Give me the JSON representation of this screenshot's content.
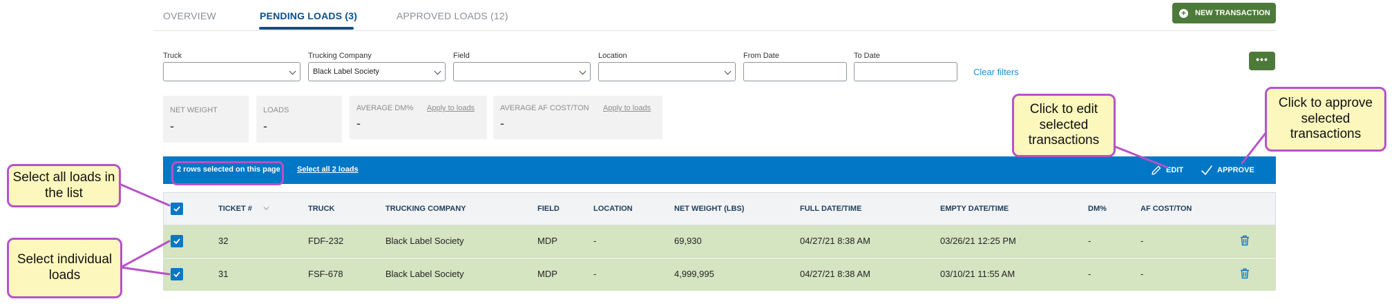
{
  "tabs": [
    {
      "label": "OVERVIEW"
    },
    {
      "label": "PENDING LOADS (3)"
    },
    {
      "label": "APPROVED LOADS (12)"
    }
  ],
  "new_transaction_label": "NEW TRANSACTION",
  "filters": {
    "truck": {
      "label": "Truck",
      "value": ""
    },
    "trucking_company": {
      "label": "Trucking Company",
      "value": "Black Label Society"
    },
    "field": {
      "label": "Field",
      "value": ""
    },
    "location": {
      "label": "Location",
      "value": ""
    },
    "from_date": {
      "label": "From Date",
      "value": ""
    },
    "to_date": {
      "label": "To Date",
      "value": ""
    },
    "clear_label": "Clear filters",
    "more_label": "•••"
  },
  "stats": [
    {
      "label": "NET WEIGHT",
      "value": "-"
    },
    {
      "label": "LOADS",
      "value": "-"
    },
    {
      "label": "AVERAGE DM%",
      "value": "-",
      "link": "Apply to loads"
    },
    {
      "label": "AVERAGE AF COST/TON",
      "value": "-",
      "link": "Apply to loads"
    }
  ],
  "selection": {
    "text": "2 rows selected on this page",
    "select_all": "Select all 2 loads",
    "edit": "EDIT",
    "approve": "APPROVE"
  },
  "table": {
    "columns": [
      "TICKET #",
      "TRUCK",
      "TRUCKING COMPANY",
      "FIELD",
      "LOCATION",
      "NET WEIGHT (LBS)",
      "FULL DATE/TIME",
      "EMPTY DATE/TIME",
      "DM%",
      "AF COST/TON"
    ],
    "rows": [
      {
        "ticket": "32",
        "truck": "FDF-232",
        "company": "Black Label Society",
        "field": "MDP",
        "location": "-",
        "net_weight": "69,930",
        "full_date": "04/27/21 8:38 AM",
        "empty_date": "03/26/21 12:25 PM",
        "dm": "-",
        "af_cost": "-"
      },
      {
        "ticket": "31",
        "truck": "FSF-678",
        "company": "Black Label Society",
        "field": "MDP",
        "location": "-",
        "net_weight": "4,999,995",
        "full_date": "04/27/21 8:38 AM",
        "empty_date": "03/10/21 11:55 AM",
        "dm": "-",
        "af_cost": "-"
      }
    ]
  },
  "callouts": {
    "select_all": "Select all loads in the list",
    "select_individual": "Select individual loads",
    "edit": "Click to edit selected transactions",
    "approve": "Click to approve selected transactions"
  },
  "colors": {
    "primary_blue": "#0277c6",
    "tab_active": "#0b4f8a",
    "action_green": "#4d7a3a",
    "row_selected": "#d5e4c1",
    "callout_fill": "#fbf7bd",
    "callout_border": "#b652c7",
    "link_blue": "#1a8dd8"
  }
}
